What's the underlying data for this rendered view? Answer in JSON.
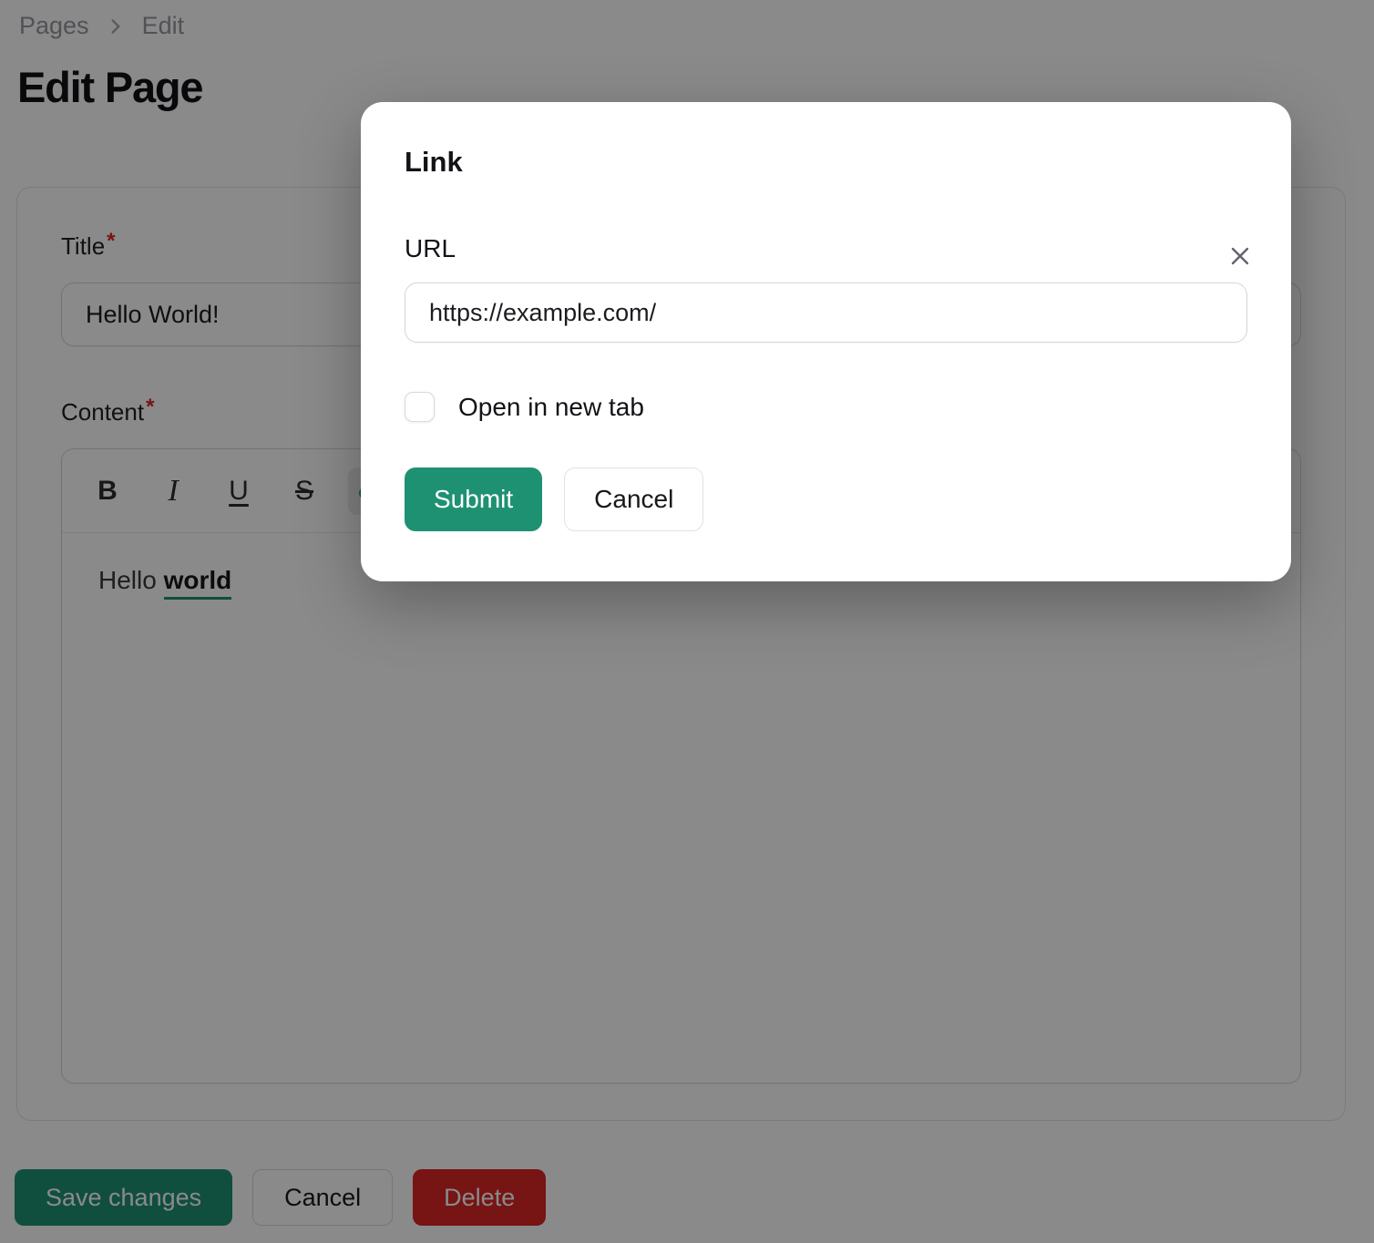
{
  "colors": {
    "accent": "#1f9173",
    "danger": "#dc2626",
    "required": "#dc2626",
    "link_underline": "#1f9173"
  },
  "page": {
    "breadcrumb": {
      "pages": "Pages",
      "edit": "Edit"
    },
    "title": "Edit Page",
    "form": {
      "title_label": "Title",
      "required_marker": "*",
      "title_value": "Hello World!",
      "content_label": "Content",
      "toolbar": {
        "bold": "B",
        "italic": "I",
        "underline": "U",
        "strikethrough": "S",
        "link_icon": "link-icon"
      },
      "content_text": "Hello ",
      "content_link_text": "world"
    },
    "actions": {
      "save": "Save changes",
      "cancel": "Cancel",
      "delete": "Delete"
    }
  },
  "modal": {
    "title": "Link",
    "url_label": "URL",
    "url_value": "https://example.com/",
    "open_in_new_tab_label": "Open in new tab",
    "checkbox_checked": false,
    "submit_label": "Submit",
    "cancel_label": "Cancel"
  }
}
